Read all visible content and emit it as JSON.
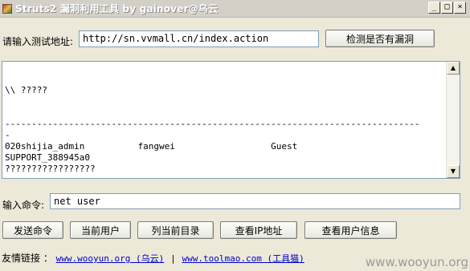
{
  "window": {
    "title": "Struts2 漏洞利用工具 by gainover@乌云",
    "minimize": "_",
    "restore": "□",
    "close": "×"
  },
  "url_row": {
    "label": "请输入测试地址:",
    "value": "http://sn.vvmall.cn/index.action",
    "check_button": "检测是否有漏洞"
  },
  "output": {
    "lines": "\n\\\\ ?????\n\n\n------------------------------------------------------------------------------\n-\n020shijia_admin          fangwei                  Guest\nSUPPORT_388945a0\n?????????????????"
  },
  "command_row": {
    "label": "输入命令:",
    "value": "net user"
  },
  "buttons": {
    "send": "发送命令",
    "current_user": "当前用户",
    "list_dir": "列当前目录",
    "ip": "查看IP地址",
    "user_info": "查看用户信息"
  },
  "footer": {
    "label": "友情链接 ：",
    "link1": "www.wooyun.org (乌云)",
    "separator": "|",
    "link2": "www.toolmao.com (工具猫)"
  },
  "watermark": "www.wooyun.org"
}
